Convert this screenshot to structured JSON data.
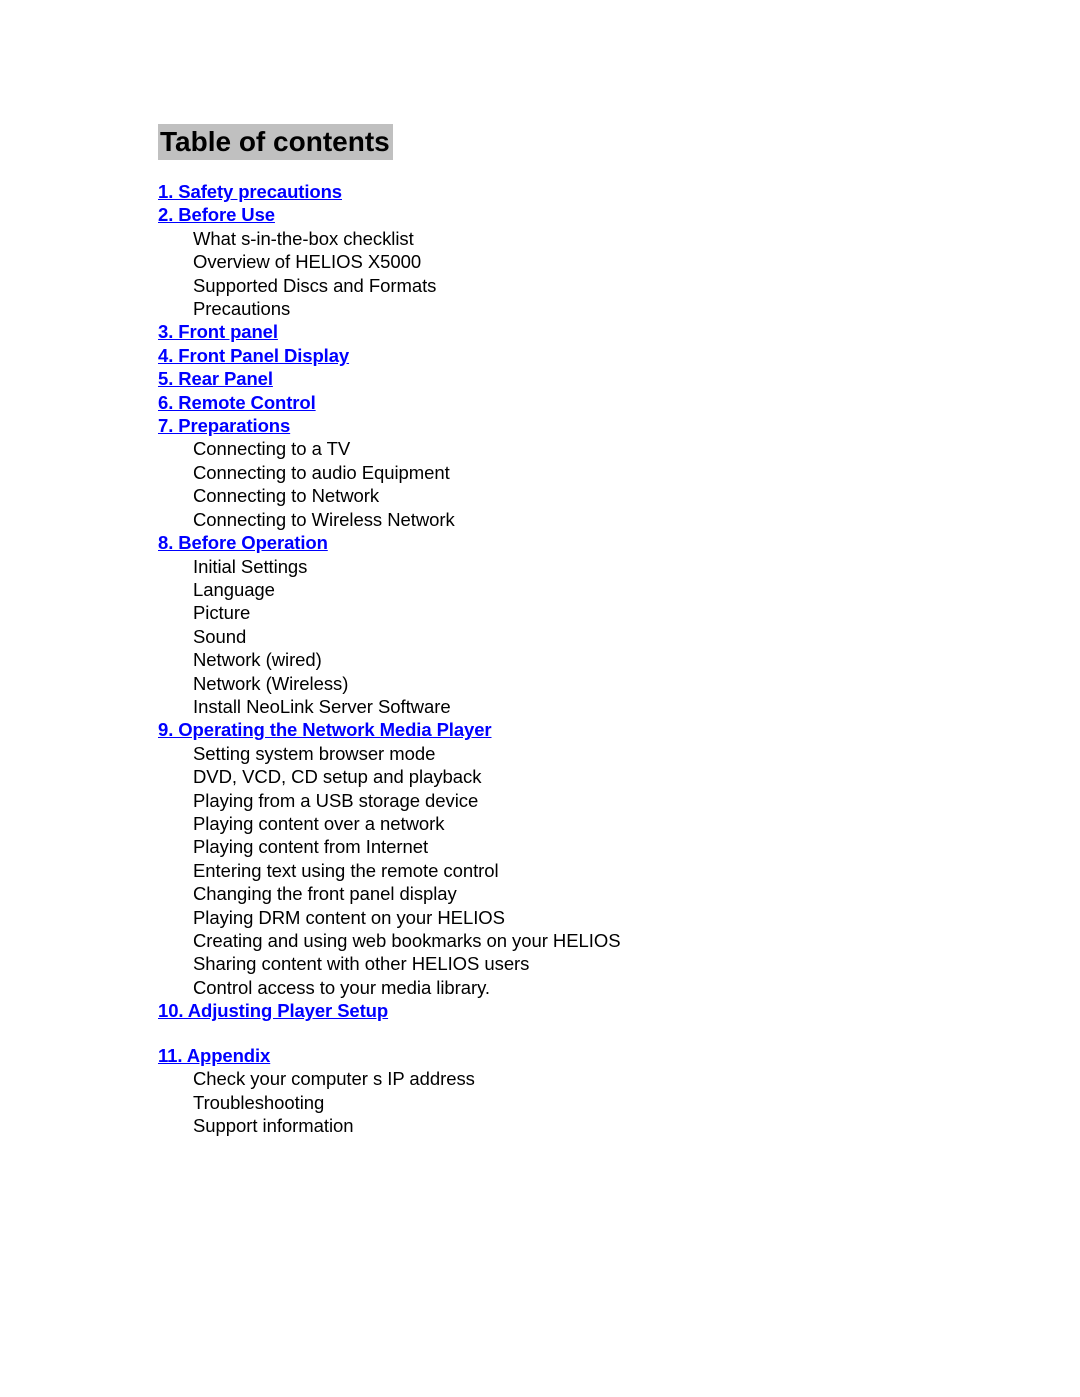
{
  "document": {
    "title": "Table of contents"
  },
  "toc": {
    "entries": [
      {
        "kind": "link",
        "label": "1. Safety precautions"
      },
      {
        "kind": "link",
        "label": "2. Before Use"
      },
      {
        "kind": "sub",
        "label": "What s-in-the-box checklist"
      },
      {
        "kind": "sub",
        "label": "Overview of HELIOS X5000"
      },
      {
        "kind": "sub",
        "label": "Supported Discs and Formats"
      },
      {
        "kind": "sub",
        "label": "Precautions"
      },
      {
        "kind": "link",
        "label": "3. Front panel"
      },
      {
        "kind": "link",
        "label": "4. Front Panel Display"
      },
      {
        "kind": "link",
        "label": "5. Rear Panel"
      },
      {
        "kind": "link",
        "label": "6. Remote Control"
      },
      {
        "kind": "link",
        "label": "7. Preparations"
      },
      {
        "kind": "sub",
        "label": "Connecting to a TV"
      },
      {
        "kind": "sub",
        "label": "Connecting to audio Equipment"
      },
      {
        "kind": "sub",
        "label": "Connecting to Network"
      },
      {
        "kind": "sub",
        "label": "Connecting to Wireless Network"
      },
      {
        "kind": "link",
        "label": "8. Before Operation"
      },
      {
        "kind": "sub",
        "label": "Initial Settings"
      },
      {
        "kind": "sub",
        "label": "Language"
      },
      {
        "kind": "sub",
        "label": "Picture"
      },
      {
        "kind": "sub",
        "label": "Sound"
      },
      {
        "kind": "sub",
        "label": "Network (wired)"
      },
      {
        "kind": "sub",
        "label": "Network (Wireless)"
      },
      {
        "kind": "sub",
        "label": "Install NeoLink Server Software"
      },
      {
        "kind": "link",
        "label": "9. Operating the Network Media Player"
      },
      {
        "kind": "sub",
        "label": "Setting system browser mode"
      },
      {
        "kind": "sub",
        "label": "DVD, VCD, CD setup and playback"
      },
      {
        "kind": "sub",
        "label": "Playing from a USB storage device"
      },
      {
        "kind": "sub",
        "label": "Playing content over a network"
      },
      {
        "kind": "sub",
        "label": "Playing content from Internet"
      },
      {
        "kind": "sub",
        "label": "Entering text using the remote control"
      },
      {
        "kind": "sub",
        "label": "Changing the front panel display"
      },
      {
        "kind": "sub",
        "label": "Playing DRM content on your HELIOS"
      },
      {
        "kind": "sub",
        "label": "Creating and using web bookmarks on your HELIOS"
      },
      {
        "kind": "sub",
        "label": "Sharing content with other HELIOS users"
      },
      {
        "kind": "sub",
        "label": "Control access to your media library."
      },
      {
        "kind": "link",
        "label": "10. Adjusting Player Setup"
      },
      {
        "kind": "spacer",
        "label": ""
      },
      {
        "kind": "link",
        "label": "11. Appendix"
      },
      {
        "kind": "sub",
        "label": "Check your computer s IP address"
      },
      {
        "kind": "sub",
        "label": "Troubleshooting"
      },
      {
        "kind": "sub",
        "label": "Support information"
      }
    ]
  },
  "colors": {
    "link": "#0000ff",
    "text": "#000000",
    "title_highlight": "#c0c0c0",
    "page_background": "#ffffff"
  }
}
